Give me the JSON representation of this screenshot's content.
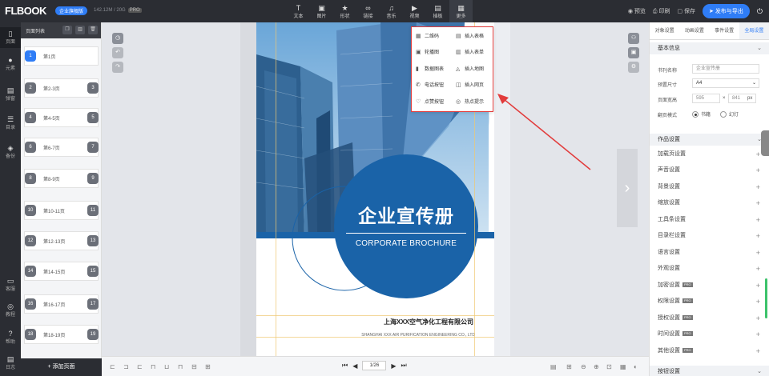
{
  "header": {
    "logo": "FLBOOK",
    "edition": "企业旗舰版",
    "storage": "142.12M / 20G",
    "pro_tag": "PRO",
    "tools": [
      {
        "label": "文本",
        "icon": "text-icon"
      },
      {
        "label": "图片",
        "icon": "image-icon"
      },
      {
        "label": "形状",
        "icon": "shape-icon"
      },
      {
        "label": "链接",
        "icon": "link-icon"
      },
      {
        "label": "音乐",
        "icon": "music-icon"
      },
      {
        "label": "视频",
        "icon": "video-icon"
      },
      {
        "label": "插板",
        "icon": "board-icon"
      },
      {
        "label": "更多",
        "icon": "more-icon"
      }
    ],
    "preview": "预览",
    "print": "印刷",
    "save": "保存",
    "publish": "发布与导出"
  },
  "leftnav": [
    {
      "label": "页面",
      "icon": "page-icon"
    },
    {
      "label": "元素",
      "icon": "element-icon"
    },
    {
      "label": "弹窗",
      "icon": "popup-icon"
    },
    {
      "label": "目录",
      "icon": "catalog-icon"
    },
    {
      "label": "备份",
      "icon": "backup-icon"
    },
    {
      "label": "客服",
      "icon": "support-icon"
    },
    {
      "label": "教程",
      "icon": "tutorial-icon"
    },
    {
      "label": "帮助",
      "icon": "help-icon"
    },
    {
      "label": "日志",
      "icon": "log-icon"
    }
  ],
  "pagelist": {
    "title": "页面列表",
    "pages": [
      {
        "left": "1",
        "label": "第1页",
        "right": ""
      },
      {
        "left": "2",
        "label": "第2-3页",
        "right": "3"
      },
      {
        "left": "4",
        "label": "第4-5页",
        "right": "5"
      },
      {
        "left": "6",
        "label": "第6-7页",
        "right": "7"
      },
      {
        "left": "8",
        "label": "第8-9页",
        "right": "9"
      },
      {
        "left": "10",
        "label": "第10-11页",
        "right": "11"
      },
      {
        "left": "12",
        "label": "第12-13页",
        "right": "13"
      },
      {
        "left": "14",
        "label": "第14-15页",
        "right": "15"
      },
      {
        "left": "16",
        "label": "第16-17页",
        "right": "17"
      },
      {
        "left": "18",
        "label": "第18-19页",
        "right": "19"
      }
    ],
    "add": "+ 添加页面"
  },
  "more_menu": [
    {
      "label": "二维码",
      "icon": "qrcode-icon"
    },
    {
      "label": "插入表格",
      "icon": "table-icon"
    },
    {
      "label": "轮播图",
      "icon": "carousel-icon"
    },
    {
      "label": "插入表单",
      "icon": "form-icon"
    },
    {
      "label": "数据图表",
      "icon": "chart-icon"
    },
    {
      "label": "插入地图",
      "icon": "map-icon"
    },
    {
      "label": "电话按钮",
      "icon": "phone-icon"
    },
    {
      "label": "插入网页",
      "icon": "webpage-icon"
    },
    {
      "label": "点赞按钮",
      "icon": "like-icon"
    },
    {
      "label": "热点提示",
      "icon": "hotspot-icon"
    }
  ],
  "cover": {
    "title_cn": "企业宣传册",
    "title_en": "CORPORATE BROCHURE",
    "company_cn": "上海XXX空气净化工程有限公司",
    "company_en": "SHANGHAI XXX AIR PURIFICATION ENGINEERING CO., LTD"
  },
  "pager": {
    "current": "1/26"
  },
  "rightpanel": {
    "tabs": [
      "对象设置",
      "动画设置",
      "事件设置",
      "全局设置"
    ],
    "basic_title": "基本信息",
    "book_name_label": "书刊名称",
    "book_name_placeholder": "企业宣传册",
    "size_label": "预置尺寸",
    "size_value": "A4",
    "page_size_label": "页面宽高",
    "width": "595",
    "height": "841",
    "unit": "px",
    "flip_label": "翻页模式",
    "flip_book": "书籍",
    "flip_slide": "幻灯",
    "works_title": "作品设置",
    "settings": [
      {
        "label": "加载页设置",
        "tag": ""
      },
      {
        "label": "声音设置",
        "tag": ""
      },
      {
        "label": "背景设置",
        "tag": ""
      },
      {
        "label": "缩放设置",
        "tag": ""
      },
      {
        "label": "工具条设置",
        "tag": ""
      },
      {
        "label": "目录栏设置",
        "tag": ""
      },
      {
        "label": "语言设置",
        "tag": ""
      },
      {
        "label": "外观设置",
        "tag": ""
      },
      {
        "label": "加密设置",
        "tag": "PRO"
      },
      {
        "label": "权限设置",
        "tag": "PRO"
      },
      {
        "label": "授权设置",
        "tag": "PRO"
      },
      {
        "label": "时间设置",
        "tag": "PRO"
      },
      {
        "label": "其他设置",
        "tag": "PRO"
      }
    ],
    "button_title": "按钮设置"
  }
}
